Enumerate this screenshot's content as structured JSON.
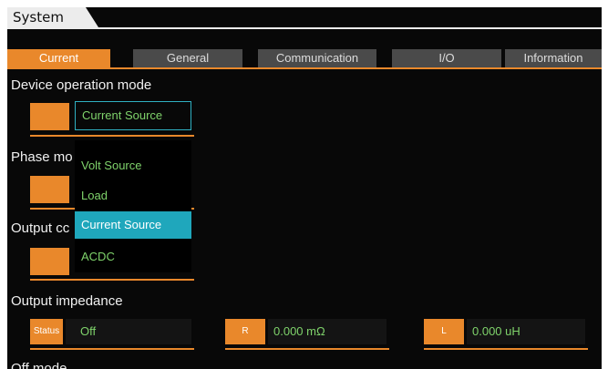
{
  "title_tab": "System",
  "tabs": [
    "Current",
    "General",
    "Communication",
    "I/O",
    "Information"
  ],
  "sections": {
    "device_operation_mode": {
      "label": "Device operation mode",
      "value": "Current Source"
    },
    "dropdown": {
      "options": [
        "Volt Source",
        "Load",
        "Current Source",
        "ACDC"
      ],
      "selected": "Current Source"
    },
    "phase_mode_label": "Phase mo",
    "output_label": "Output cc",
    "output_impedance": {
      "label": "Output impedance",
      "status_label": "Status",
      "status_value": "Off",
      "r_label": "R",
      "r_value": "0.000 mΩ",
      "l_label": "L",
      "l_value": "0.000 uH"
    },
    "off_mode_label": "Off mode"
  },
  "colors": {
    "accent": "#e9882b",
    "highlight": "#1fa7bc",
    "value_text": "#7fd36b",
    "background": "#080808"
  }
}
